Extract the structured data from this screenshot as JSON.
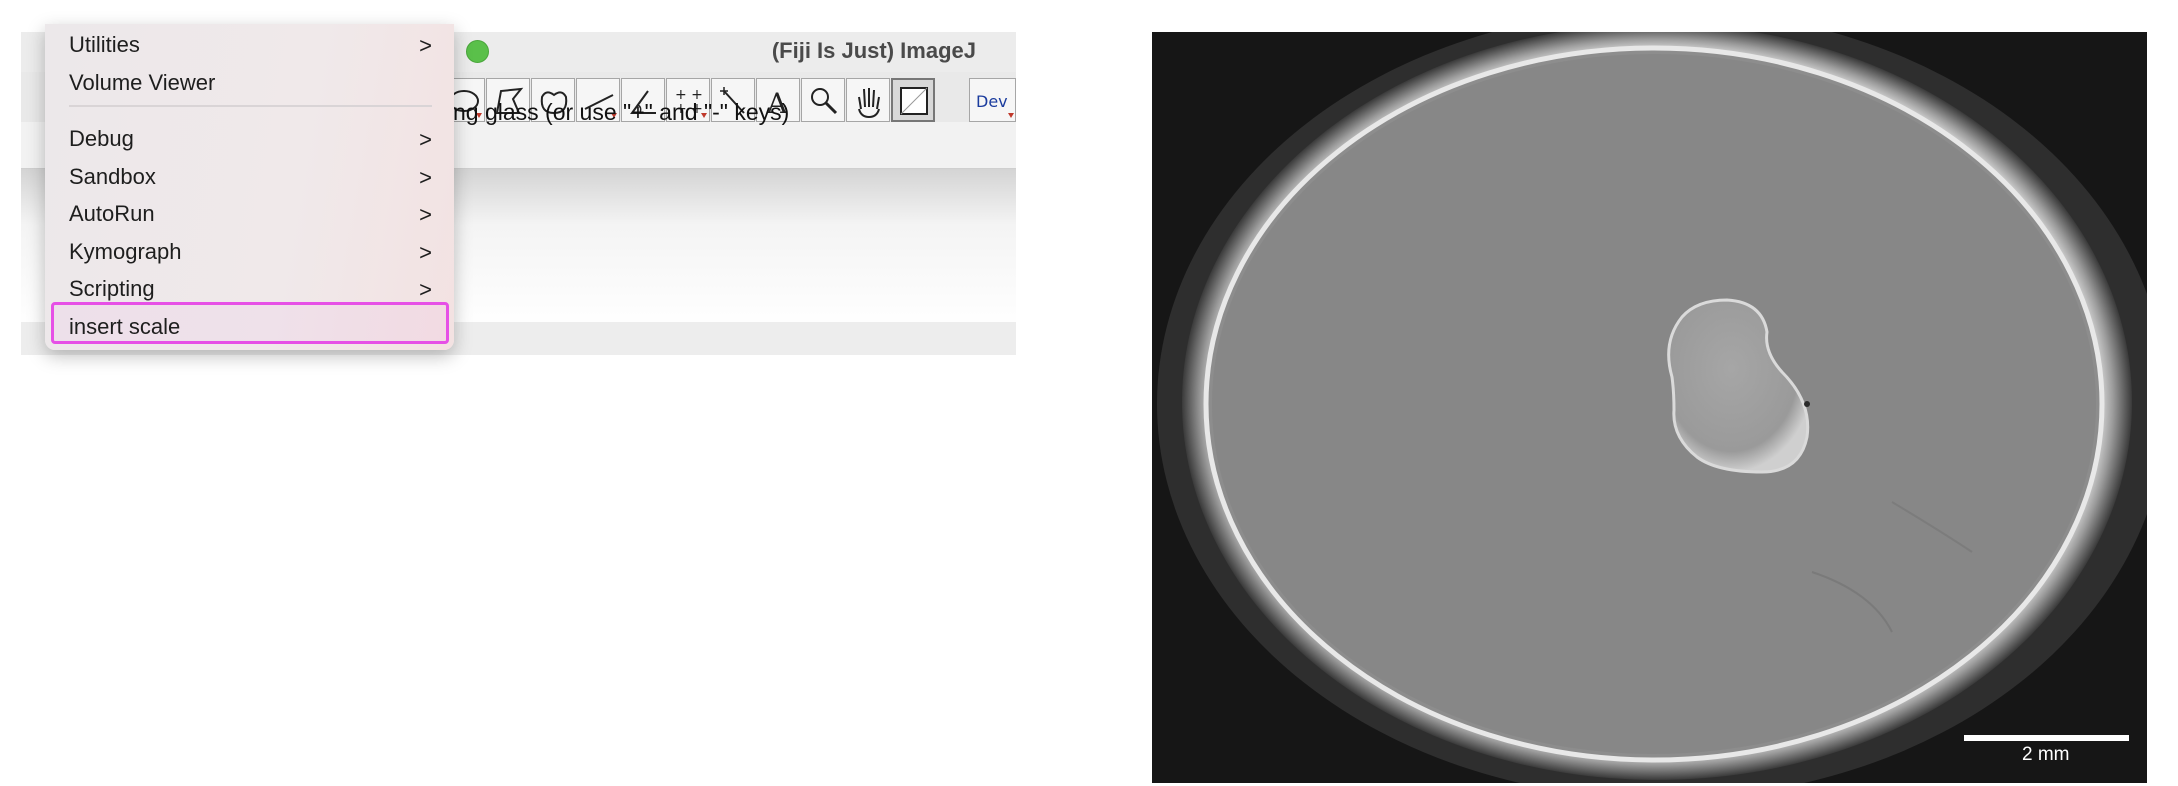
{
  "imagej": {
    "title": "(Fiji Is Just) ImageJ",
    "status_text": "fying glass (or use \"+\" and \"-\" keys)",
    "tool_icons": [
      "oval-tool-icon",
      "polygon-tool-icon",
      "freehand-tool-icon",
      "line-tool-icon",
      "angle-tool-icon",
      "multipoint-tool-icon",
      "wand-tool-icon",
      "text-tool-icon",
      "magnifier-tool-icon",
      "hand-tool-icon",
      "color-picker-tool-icon"
    ],
    "dev_label": "Dev"
  },
  "menu": {
    "items": [
      {
        "label": "Utilities",
        "submenu": true
      },
      {
        "label": "Volume Viewer",
        "submenu": false
      },
      {
        "label": "Debug",
        "submenu": true
      },
      {
        "label": "Sandbox",
        "submenu": true
      },
      {
        "label": "AutoRun",
        "submenu": true
      },
      {
        "label": "Kymograph",
        "submenu": true
      },
      {
        "label": "Scripting",
        "submenu": true
      },
      {
        "label": "insert scale",
        "submenu": false,
        "highlighted": true
      }
    ],
    "chevron": ">"
  },
  "image": {
    "scale_label": "2 mm"
  },
  "colors": {
    "highlight": "#e650e6",
    "traffic_green": "#5ac04a"
  }
}
